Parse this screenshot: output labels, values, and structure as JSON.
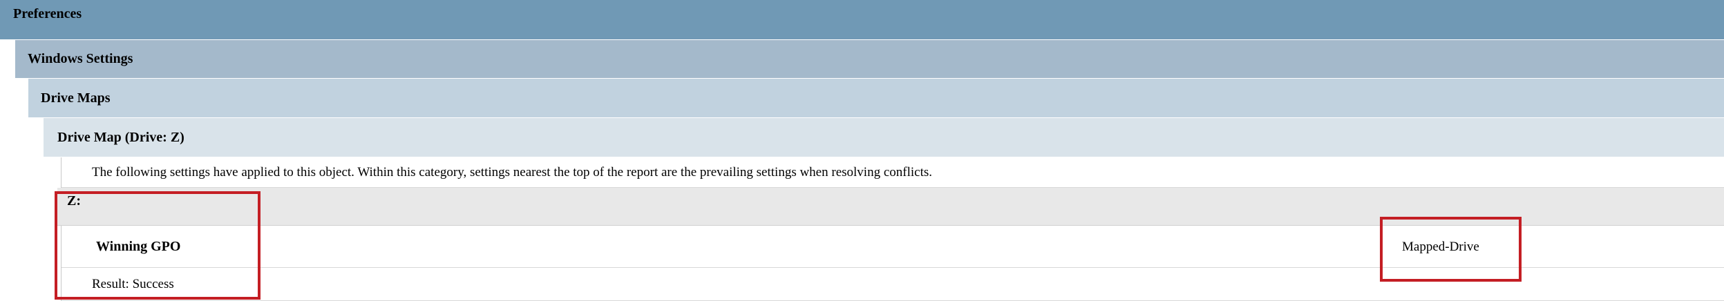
{
  "report": {
    "level1_title": "Preferences",
    "level2_title": "Windows Settings",
    "level3_title": "Drive Maps",
    "level4_title": "Drive Map (Drive: Z)",
    "info_text": "The following settings have applied to this object. Within this category, settings nearest the top of the report are the prevailing settings when resolving conflicts.",
    "drive_header": "Z:",
    "winning_gpo_label": "Winning GPO",
    "winning_gpo_value": "Mapped-Drive",
    "result_text": "Result: Success"
  },
  "colors": {
    "level1_bg": "#7099b5",
    "level2_bg": "#a4b9cb",
    "level3_bg": "#c1d2df",
    "level4_bg": "#d9e3ea",
    "subheader_bg": "#e8e8e8",
    "highlight_border": "#c41e24"
  }
}
